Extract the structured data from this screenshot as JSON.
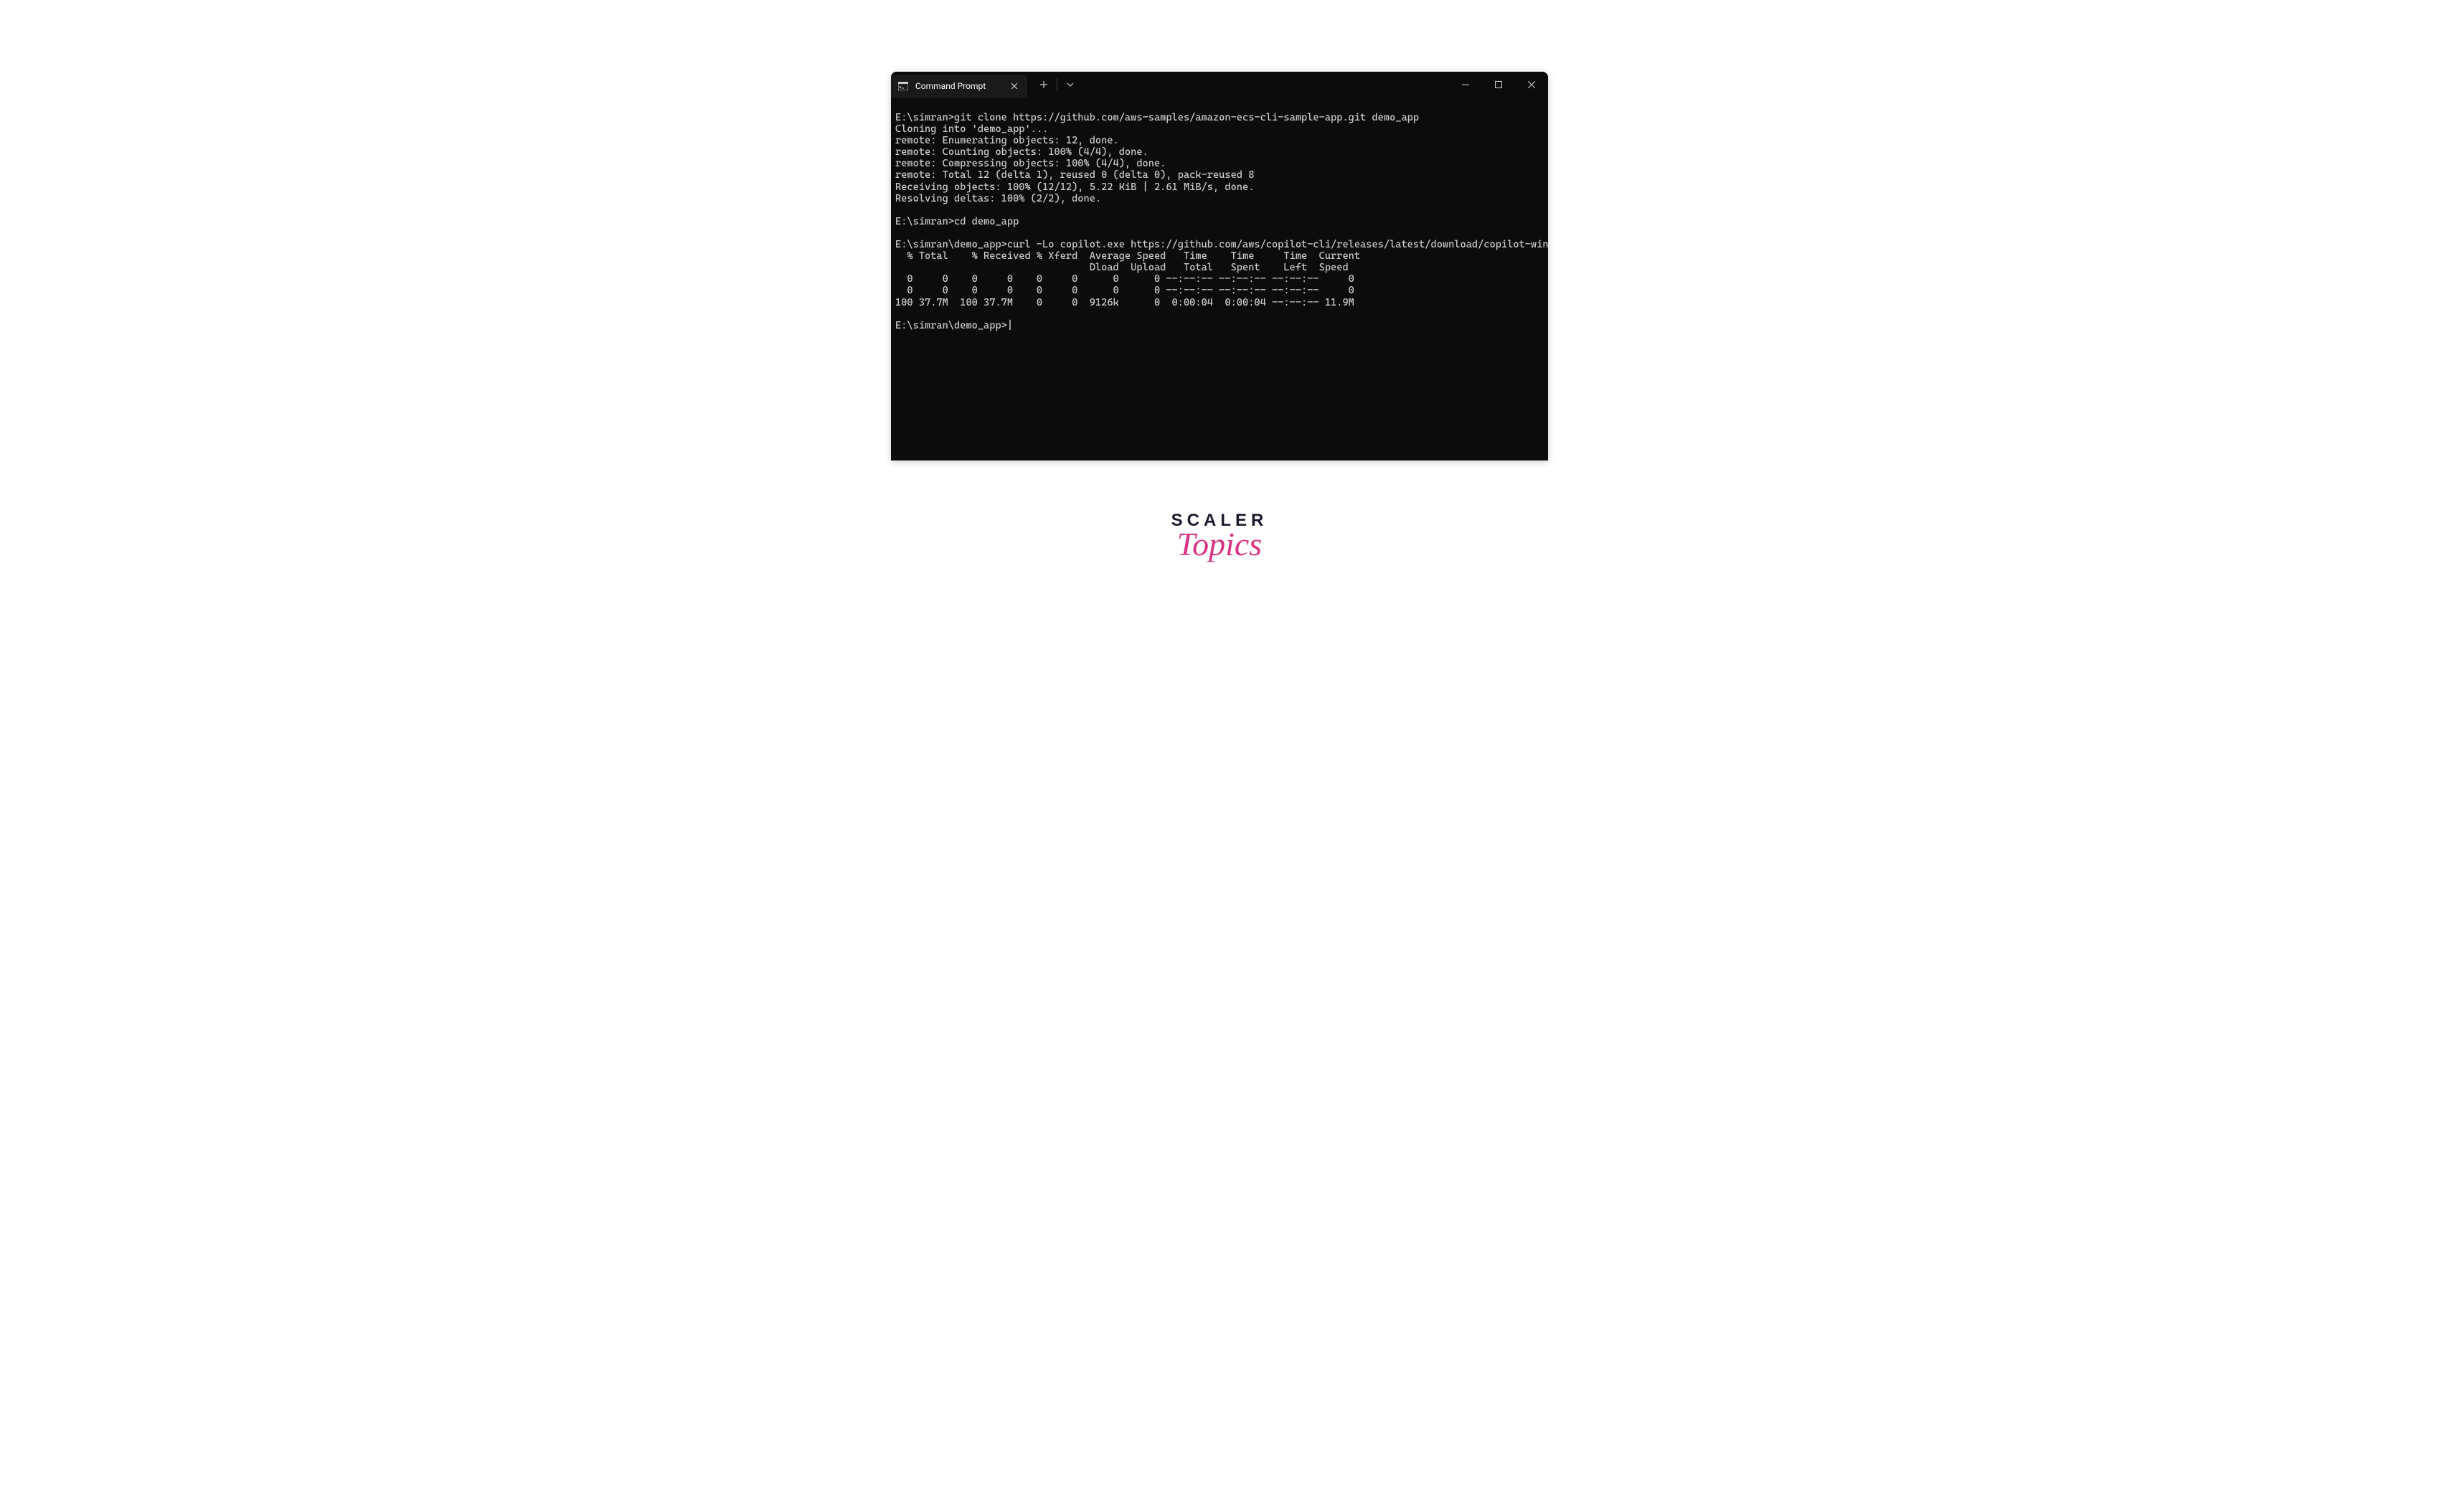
{
  "tab": {
    "title": "Command Prompt"
  },
  "terminal": {
    "lines": [
      "E:\\simran>git clone https://github.com/aws-samples/amazon-ecs-cli-sample-app.git demo_app",
      "Cloning into 'demo_app'...",
      "remote: Enumerating objects: 12, done.",
      "remote: Counting objects: 100% (4/4), done.",
      "remote: Compressing objects: 100% (4/4), done.",
      "remote: Total 12 (delta 1), reused 0 (delta 0), pack-reused 8",
      "Receiving objects: 100% (12/12), 5.22 KiB | 2.61 MiB/s, done.",
      "Resolving deltas: 100% (2/2), done.",
      "",
      "E:\\simran>cd demo_app",
      "",
      "E:\\simran\\demo_app>curl -Lo copilot.exe https://github.com/aws/copilot-cli/releases/latest/download/copilot-windows.exe",
      "  % Total    % Received % Xferd  Average Speed   Time    Time     Time  Current",
      "                                 Dload  Upload   Total   Spent    Left  Speed",
      "  0     0    0     0    0     0      0      0 --:--:-- --:--:-- --:--:--     0",
      "  0     0    0     0    0     0      0      0 --:--:-- --:--:-- --:--:--     0",
      "100 37.7M  100 37.7M    0     0  9126k      0  0:00:04  0:00:04 --:--:-- 11.9M",
      "",
      "E:\\simran\\demo_app>"
    ],
    "prompt_cursor": "|"
  },
  "watermark": {
    "line1": "SCALER",
    "line2": "Topics"
  }
}
